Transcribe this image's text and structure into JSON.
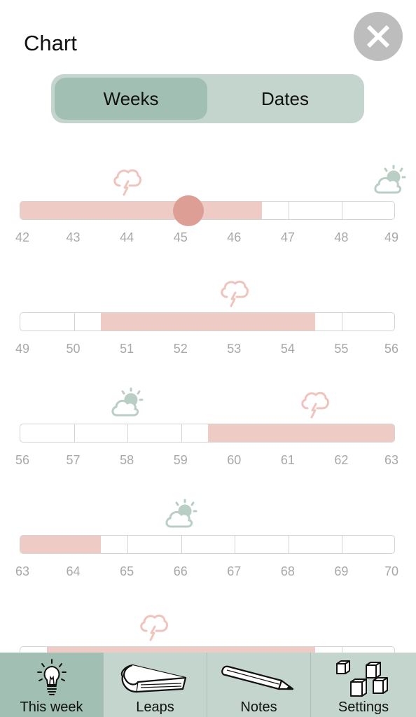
{
  "header": {
    "title": "Chart",
    "close_icon": "close-icon"
  },
  "segmented": {
    "options": [
      "Weeks",
      "Dates"
    ],
    "selected": "Weeks"
  },
  "colors": {
    "fill": "#efcbc6",
    "marker": "#dd9e95",
    "storm": "#efc4be",
    "sun": "#b9cfc5",
    "tab_bg": "#c3d5cc",
    "tab_active": "#a2bfb3"
  },
  "chart_data": {
    "type": "table",
    "title": "Chart",
    "unit": "weeks",
    "current_week": 45.15,
    "rows": [
      {
        "range": [
          42,
          49
        ],
        "ticks": [
          "42",
          "43",
          "44",
          "45",
          "46",
          "47",
          "48",
          "49"
        ],
        "filled": [
          [
            42,
            46.5
          ]
        ],
        "icons": [
          {
            "type": "storm",
            "week": 44
          },
          {
            "type": "sunny-cloud",
            "week": 49
          }
        ],
        "marker": 45.15
      },
      {
        "range": [
          49,
          56
        ],
        "ticks": [
          "49",
          "50",
          "51",
          "52",
          "53",
          "54",
          "55",
          "56"
        ],
        "filled": [
          [
            50.5,
            54.5
          ]
        ],
        "icons": [
          {
            "type": "storm",
            "week": 53
          }
        ]
      },
      {
        "range": [
          56,
          63
        ],
        "ticks": [
          "56",
          "57",
          "58",
          "59",
          "60",
          "61",
          "62",
          "63"
        ],
        "filled": [
          [
            59.5,
            63
          ]
        ],
        "icons": [
          {
            "type": "sunny-cloud",
            "week": 58
          },
          {
            "type": "storm",
            "week": 61.5
          }
        ]
      },
      {
        "range": [
          63,
          70
        ],
        "ticks": [
          "63",
          "64",
          "65",
          "66",
          "67",
          "68",
          "69",
          "70"
        ],
        "filled": [
          [
            63,
            64.5
          ]
        ],
        "icons": [
          {
            "type": "sunny-cloud",
            "week": 66
          }
        ]
      },
      {
        "range": [
          70,
          77
        ],
        "ticks": [],
        "filled": [
          [
            70.5,
            75.5
          ]
        ],
        "icons": [
          {
            "type": "storm",
            "week": 72.5
          }
        ]
      }
    ]
  },
  "tabbar": {
    "tabs": [
      {
        "label": "This week",
        "icon": "lightbulb-icon",
        "active": true
      },
      {
        "label": "Leaps",
        "icon": "book-icon",
        "active": false
      },
      {
        "label": "Notes",
        "icon": "pencil-icon",
        "active": false
      },
      {
        "label": "Settings",
        "icon": "blocks-icon",
        "active": false
      }
    ]
  }
}
